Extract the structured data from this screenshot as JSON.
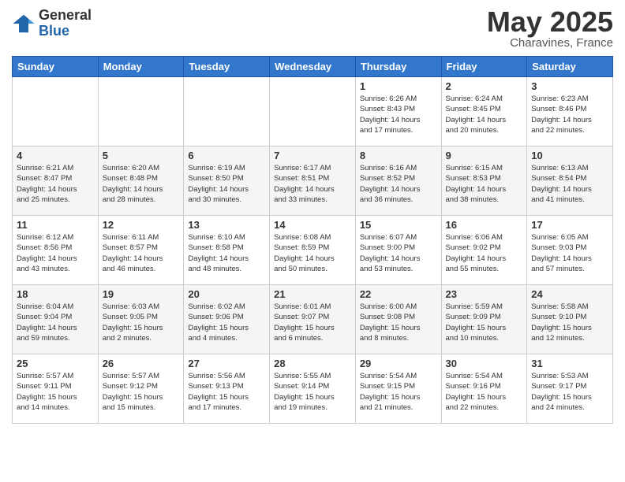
{
  "header": {
    "logo_general": "General",
    "logo_blue": "Blue",
    "month": "May 2025",
    "location": "Charavines, France"
  },
  "weekdays": [
    "Sunday",
    "Monday",
    "Tuesday",
    "Wednesday",
    "Thursday",
    "Friday",
    "Saturday"
  ],
  "weeks": [
    [
      {
        "day": "",
        "detail": ""
      },
      {
        "day": "",
        "detail": ""
      },
      {
        "day": "",
        "detail": ""
      },
      {
        "day": "",
        "detail": ""
      },
      {
        "day": "1",
        "detail": "Sunrise: 6:26 AM\nSunset: 8:43 PM\nDaylight: 14 hours\nand 17 minutes."
      },
      {
        "day": "2",
        "detail": "Sunrise: 6:24 AM\nSunset: 8:45 PM\nDaylight: 14 hours\nand 20 minutes."
      },
      {
        "day": "3",
        "detail": "Sunrise: 6:23 AM\nSunset: 8:46 PM\nDaylight: 14 hours\nand 22 minutes."
      }
    ],
    [
      {
        "day": "4",
        "detail": "Sunrise: 6:21 AM\nSunset: 8:47 PM\nDaylight: 14 hours\nand 25 minutes."
      },
      {
        "day": "5",
        "detail": "Sunrise: 6:20 AM\nSunset: 8:48 PM\nDaylight: 14 hours\nand 28 minutes."
      },
      {
        "day": "6",
        "detail": "Sunrise: 6:19 AM\nSunset: 8:50 PM\nDaylight: 14 hours\nand 30 minutes."
      },
      {
        "day": "7",
        "detail": "Sunrise: 6:17 AM\nSunset: 8:51 PM\nDaylight: 14 hours\nand 33 minutes."
      },
      {
        "day": "8",
        "detail": "Sunrise: 6:16 AM\nSunset: 8:52 PM\nDaylight: 14 hours\nand 36 minutes."
      },
      {
        "day": "9",
        "detail": "Sunrise: 6:15 AM\nSunset: 8:53 PM\nDaylight: 14 hours\nand 38 minutes."
      },
      {
        "day": "10",
        "detail": "Sunrise: 6:13 AM\nSunset: 8:54 PM\nDaylight: 14 hours\nand 41 minutes."
      }
    ],
    [
      {
        "day": "11",
        "detail": "Sunrise: 6:12 AM\nSunset: 8:56 PM\nDaylight: 14 hours\nand 43 minutes."
      },
      {
        "day": "12",
        "detail": "Sunrise: 6:11 AM\nSunset: 8:57 PM\nDaylight: 14 hours\nand 46 minutes."
      },
      {
        "day": "13",
        "detail": "Sunrise: 6:10 AM\nSunset: 8:58 PM\nDaylight: 14 hours\nand 48 minutes."
      },
      {
        "day": "14",
        "detail": "Sunrise: 6:08 AM\nSunset: 8:59 PM\nDaylight: 14 hours\nand 50 minutes."
      },
      {
        "day": "15",
        "detail": "Sunrise: 6:07 AM\nSunset: 9:00 PM\nDaylight: 14 hours\nand 53 minutes."
      },
      {
        "day": "16",
        "detail": "Sunrise: 6:06 AM\nSunset: 9:02 PM\nDaylight: 14 hours\nand 55 minutes."
      },
      {
        "day": "17",
        "detail": "Sunrise: 6:05 AM\nSunset: 9:03 PM\nDaylight: 14 hours\nand 57 minutes."
      }
    ],
    [
      {
        "day": "18",
        "detail": "Sunrise: 6:04 AM\nSunset: 9:04 PM\nDaylight: 14 hours\nand 59 minutes."
      },
      {
        "day": "19",
        "detail": "Sunrise: 6:03 AM\nSunset: 9:05 PM\nDaylight: 15 hours\nand 2 minutes."
      },
      {
        "day": "20",
        "detail": "Sunrise: 6:02 AM\nSunset: 9:06 PM\nDaylight: 15 hours\nand 4 minutes."
      },
      {
        "day": "21",
        "detail": "Sunrise: 6:01 AM\nSunset: 9:07 PM\nDaylight: 15 hours\nand 6 minutes."
      },
      {
        "day": "22",
        "detail": "Sunrise: 6:00 AM\nSunset: 9:08 PM\nDaylight: 15 hours\nand 8 minutes."
      },
      {
        "day": "23",
        "detail": "Sunrise: 5:59 AM\nSunset: 9:09 PM\nDaylight: 15 hours\nand 10 minutes."
      },
      {
        "day": "24",
        "detail": "Sunrise: 5:58 AM\nSunset: 9:10 PM\nDaylight: 15 hours\nand 12 minutes."
      }
    ],
    [
      {
        "day": "25",
        "detail": "Sunrise: 5:57 AM\nSunset: 9:11 PM\nDaylight: 15 hours\nand 14 minutes."
      },
      {
        "day": "26",
        "detail": "Sunrise: 5:57 AM\nSunset: 9:12 PM\nDaylight: 15 hours\nand 15 minutes."
      },
      {
        "day": "27",
        "detail": "Sunrise: 5:56 AM\nSunset: 9:13 PM\nDaylight: 15 hours\nand 17 minutes."
      },
      {
        "day": "28",
        "detail": "Sunrise: 5:55 AM\nSunset: 9:14 PM\nDaylight: 15 hours\nand 19 minutes."
      },
      {
        "day": "29",
        "detail": "Sunrise: 5:54 AM\nSunset: 9:15 PM\nDaylight: 15 hours\nand 21 minutes."
      },
      {
        "day": "30",
        "detail": "Sunrise: 5:54 AM\nSunset: 9:16 PM\nDaylight: 15 hours\nand 22 minutes."
      },
      {
        "day": "31",
        "detail": "Sunrise: 5:53 AM\nSunset: 9:17 PM\nDaylight: 15 hours\nand 24 minutes."
      }
    ]
  ]
}
